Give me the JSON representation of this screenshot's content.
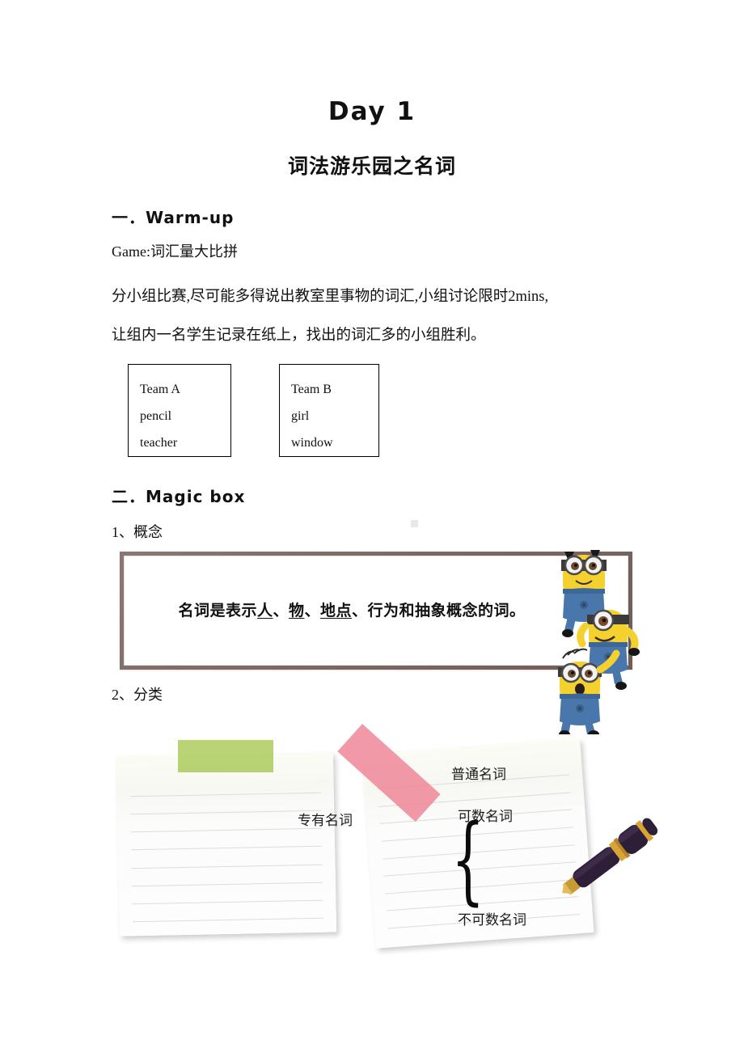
{
  "document": {
    "title": "Day 1",
    "subtitle": "词法游乐园之名词"
  },
  "sections": {
    "warmup": {
      "heading": "一．Warm-up",
      "game_line": "Game:词汇量大比拼",
      "description_line_1": "分小组比赛,尽可能多得说出教室里事物的词汇,小组讨论限时2mins,",
      "description_line_2": "让组内一名学生记录在纸上，找出的词汇多的小组胜利。",
      "teams": [
        {
          "name": "Team A",
          "words": [
            "pencil",
            "teacher"
          ]
        },
        {
          "name": "Team B",
          "words": [
            "girl",
            "window"
          ]
        }
      ]
    },
    "magicbox": {
      "heading": "二．Magic box",
      "subsection_1": "1、概念",
      "definition": {
        "prefix": "名词是表示",
        "u1": "人",
        "sep1": "、",
        "u2": "物",
        "sep2": "、",
        "u3": "地点",
        "suffix": "、行为和抽象概念的词。"
      },
      "subsection_2": "2、分类",
      "notes": {
        "left": {
          "label": "专有名词"
        },
        "right": {
          "label_common": "普通名词",
          "label_countable": "可数名词",
          "label_uncountable": "不可数名词",
          "brace": "{"
        }
      }
    }
  },
  "colors": {
    "tape_green": "#a9c957",
    "tape_pink": "#ef8296",
    "whiteboard_frame": "#7c6b65",
    "minion_yellow": "#f7d33f",
    "minion_blue": "#3f6ea5",
    "pen_body": "#2a1b33",
    "pen_gold": "#d9a436"
  }
}
